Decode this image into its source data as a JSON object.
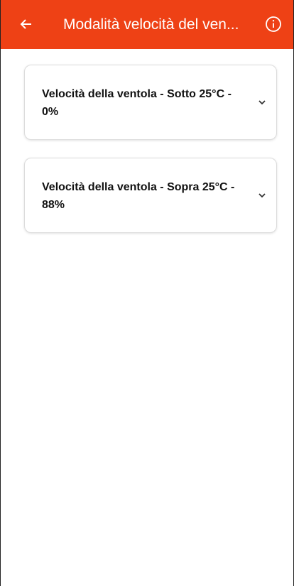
{
  "appbar": {
    "title": "Modalità velocità del ven...",
    "back_icon": "arrow-left-icon",
    "info_icon": "info-circle-icon",
    "background_color": "#ee4115"
  },
  "settings": [
    {
      "label": "Velocità della ventola - Sotto 25°C - 0%",
      "icon": "chevron-down-icon"
    },
    {
      "label": "Velocità della ventola - Sopra 25°C - 88%",
      "icon": "chevron-down-icon"
    }
  ]
}
